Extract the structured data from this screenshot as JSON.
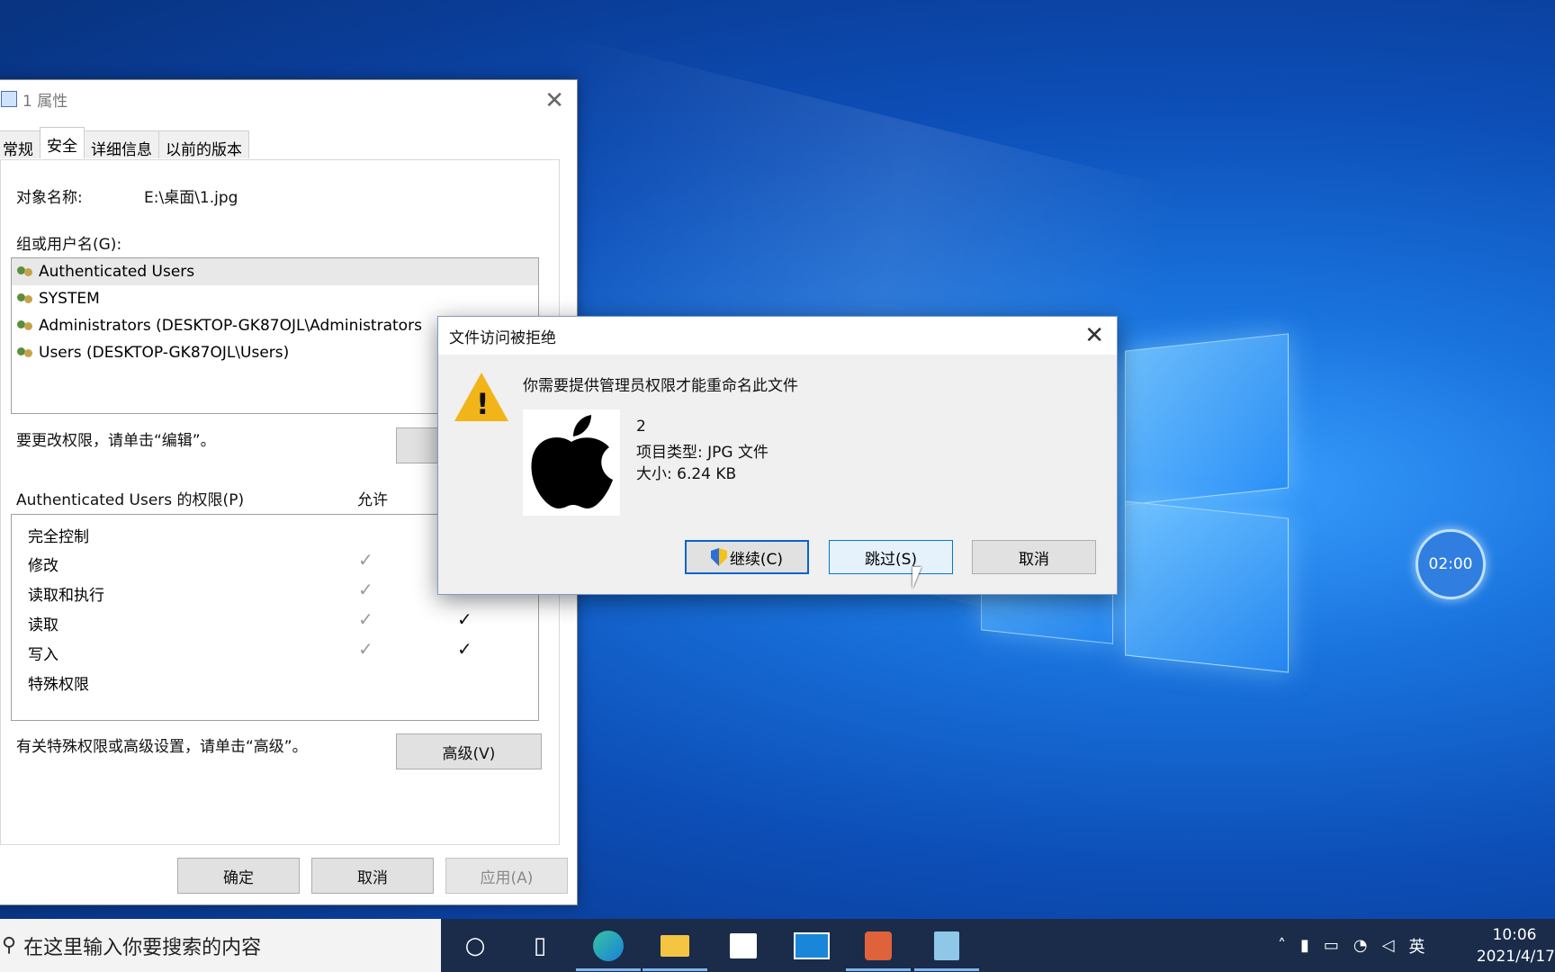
{
  "props_window": {
    "title": "1 属性",
    "tabs": [
      "常规",
      "安全",
      "详细信息",
      "以前的版本"
    ],
    "object_label": "对象名称:",
    "object_value": "E:\\桌面\\1.jpg",
    "groups_label": "组或用户名(G):",
    "users": [
      "Authenticated Users",
      "SYSTEM",
      "Administrators (DESKTOP-GK87OJL\\Administrators",
      "Users (DESKTOP-GK87OJL\\Users)"
    ],
    "change_hint": "要更改权限，请单击“编辑”。",
    "perm_label": "Authenticated Users 的权限(P)",
    "allow_col": "允许",
    "permissions": [
      "完全控制",
      "修改",
      "读取和执行",
      "读取",
      "写入",
      "特殊权限"
    ],
    "advanced_hint": "有关特殊权限或高级设置，请单击“高级”。",
    "advanced_btn": "高级(V)",
    "ok_btn": "确定",
    "cancel_btn": "取消",
    "apply_btn": "应用(A)"
  },
  "dialog": {
    "title": "文件访问被拒绝",
    "message": "你需要提供管理员权限才能重命名此文件",
    "file_name": "2",
    "file_type": "项目类型: JPG 文件",
    "file_size": "大小: 6.24 KB",
    "continue_btn": "继续(C)",
    "skip_btn": "跳过(S)",
    "cancel_btn": "取消"
  },
  "timer": {
    "value": "02:00"
  },
  "taskbar": {
    "search_placeholder": "在这里输入你要搜索的内容",
    "ime": "英",
    "time": "10:06",
    "date": "2021/4/17"
  }
}
